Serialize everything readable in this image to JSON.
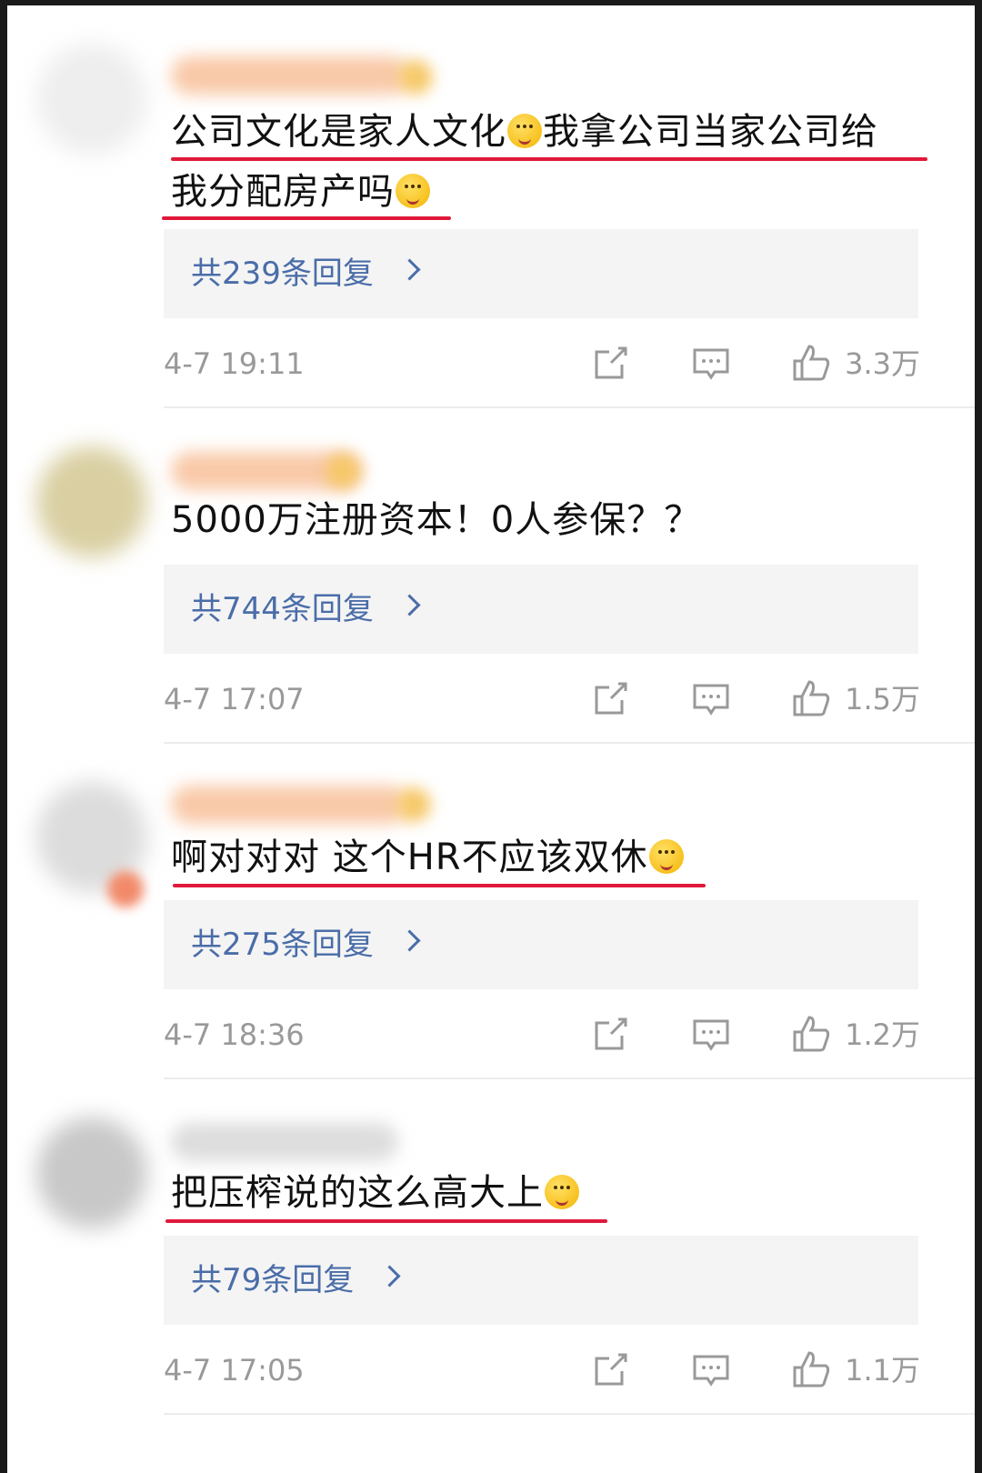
{
  "comments": [
    {
      "text_lines": [
        "公司文化是家人文化",
        "我拿公司当家公司给",
        "我分配房产吗"
      ],
      "replies": "共239条回复",
      "time": "4-7 19:11",
      "likes": "3.3万"
    },
    {
      "text_lines": [
        "5000万注册资本！0人参保？？"
      ],
      "replies": "共744条回复",
      "time": "4-7 17:07",
      "likes": "1.5万"
    },
    {
      "text_lines": [
        "啊对对对 这个HR不应该双休"
      ],
      "replies": "共275条回复",
      "time": "4-7 18:36",
      "likes": "1.2万"
    },
    {
      "text_lines": [
        "把压榨说的这么高大上"
      ],
      "replies": "共79条回复",
      "time": "4-7 17:05",
      "likes": "1.1万"
    }
  ],
  "icons": {
    "share": "share-icon",
    "comment": "comment-icon",
    "like": "thumbs-up-icon",
    "chevron": "chevron-right-icon"
  },
  "colors": {
    "underline": "#e0193a",
    "reply_link": "#4a6da8",
    "reply_bg": "#f4f4f4",
    "meta": "#999999"
  }
}
